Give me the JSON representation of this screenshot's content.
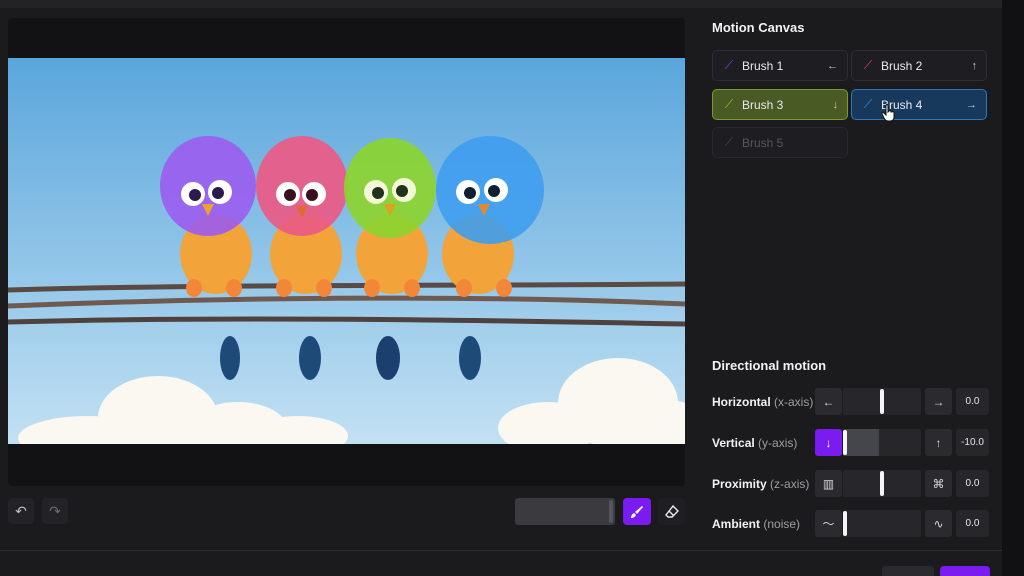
{
  "motion_canvas": {
    "title": "Motion Canvas",
    "brushes": [
      {
        "label": "Brush 1",
        "direction_icon": "←",
        "icon": "brush-icon",
        "color": "#8a3cf0",
        "state": "normal"
      },
      {
        "label": "Brush 2",
        "direction_icon": "↑",
        "icon": "brush-icon",
        "color": "#e0408a",
        "state": "normal"
      },
      {
        "label": "Brush 3",
        "direction_icon": "↓",
        "icon": "brush-icon",
        "color": "#8fd12a",
        "state": "selected"
      },
      {
        "label": "Brush 4",
        "direction_icon": "→",
        "icon": "brush-icon",
        "color": "#2f8ff0",
        "state": "selected"
      },
      {
        "label": "Brush 5",
        "direction_icon": "",
        "icon": "brush-icon",
        "color": "#4a4a50",
        "state": "disabled"
      }
    ]
  },
  "directional_motion": {
    "title": "Directional motion",
    "rows": [
      {
        "label": "Horizontal",
        "axis": "(x-axis)",
        "left_icon": "←",
        "right_icon": "→",
        "value": "0.0",
        "level": 0.5
      },
      {
        "label": "Vertical",
        "axis": "(y-axis)",
        "left_icon": "↓",
        "right_icon": "↑",
        "value": "-10.0",
        "level": 0.0
      },
      {
        "label": "Proximity",
        "axis": "(z-axis)",
        "left_icon": "▥",
        "right_icon": "⌘",
        "value": "0.0",
        "level": 0.5
      },
      {
        "label": "Ambient",
        "axis": "(noise)",
        "left_icon": "〜",
        "right_icon": "∿",
        "value": "0.0",
        "level": 0.0
      }
    ]
  },
  "toolbar": {
    "undo_icon": "↶",
    "redo_icon": "↷",
    "brush_icon": "🖌",
    "eraser_icon": "⌫"
  },
  "colors": {
    "accent": "#7a1cf0",
    "sky_top": "#5aa6dc",
    "sky_bottom": "#bfe0f2"
  }
}
